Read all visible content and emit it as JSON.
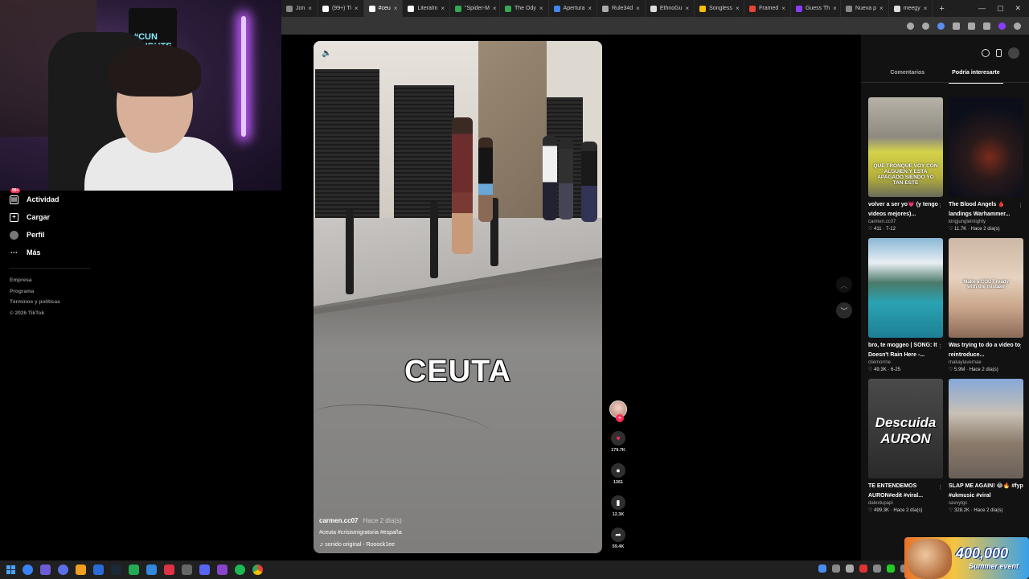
{
  "browser": {
    "tabs": [
      {
        "label": "Jon",
        "color": "#888",
        "active": false
      },
      {
        "label": "(99+) Ti",
        "color": "#fff",
        "active": false
      },
      {
        "label": "#ceu",
        "color": "#fff",
        "active": true
      },
      {
        "label": "Literalm",
        "color": "#fff",
        "active": false
      },
      {
        "label": "\"Spider-M",
        "color": "#34a853",
        "active": false
      },
      {
        "label": "The Ody",
        "color": "#34a853",
        "active": false
      },
      {
        "label": "Apertura",
        "color": "#4285f4",
        "active": false
      },
      {
        "label": "Rule34d",
        "color": "#aaa",
        "active": false
      },
      {
        "label": "EthnoGu",
        "color": "#ddd",
        "active": false
      },
      {
        "label": "Songless",
        "color": "#fbbc05",
        "active": false
      },
      {
        "label": "Framed",
        "color": "#ea4335",
        "active": false
      },
      {
        "label": "Guess Th",
        "color": "#8a3cff",
        "active": false
      },
      {
        "label": "Nueva p",
        "color": "#888",
        "active": false
      },
      {
        "label": "meegy",
        "color": "#ddd",
        "active": false
      }
    ]
  },
  "sidebar": {
    "items": [
      {
        "label": "Actividad",
        "icon": "inbox-icon",
        "badge": "99+"
      },
      {
        "label": "Cargar",
        "icon": "upload-plus-icon"
      },
      {
        "label": "Perfil",
        "icon": "profile-avatar-icon"
      },
      {
        "label": "Más",
        "icon": "more-dots-icon"
      }
    ],
    "footer": [
      "Empresa",
      "Programa",
      "Términos y políticas",
      "© 2026 TikTok"
    ]
  },
  "video": {
    "caption": "CEUTA",
    "author": "carmen.cc07",
    "posted": "Hace 2 día(s)",
    "tags": "#ceuta #crisismigratoria #españa",
    "sound": "sonido original - Rooock1ee",
    "likes": "179.7K",
    "comments": "1361",
    "saves": "12.3K",
    "shares": "59.4K"
  },
  "panel": {
    "tabs": [
      "Comentarios",
      "Podría interesarte"
    ],
    "active_tab": "Podría interesarte",
    "cards": [
      {
        "title": "volver a ser yo💗 (y tengo videos mejores)...",
        "author": "carmen.cc07",
        "stats": "♡ 411 · 7-12",
        "thumb_text": "QUE TRONQUE VOY CON ALGUIEN Y ESTA APAGADO SIENDO YO TAN ESTE",
        "thumb": "yellow"
      },
      {
        "title": "The Blood Angels 🩸 landings Warhammer...",
        "author": "kingjungleimighty",
        "stats": "♡ 11.7K · Hace 2 día(s)",
        "thumb_text": "",
        "thumb": "dark"
      },
      {
        "title": "bro, te moggeo | SONG: It Doesn't Rain Here -...",
        "author": "cliemorrne",
        "stats": "♡ 49.3K · 6-25",
        "thumb_text": "",
        "thumb": "lake"
      },
      {
        "title": "Was trying to do a video to reintroduce...",
        "author": "makaylavernae",
        "stats": "♡ 5.9M · Hace 2 día(s)",
        "thumb_text": "Make a COUT ready with the mistake",
        "thumb": "girl"
      },
      {
        "title": "TE ENTENDEMOS AURON#edit #viral...",
        "author": "dalextupapi",
        "stats": "♡ 499.3K · Hace 2 día(s)",
        "thumb_text": "Descuida AURON",
        "thumb": "auron"
      },
      {
        "title": "SLAP ME AGAIN! 😂🔥 #fyp #ukmusic #viral",
        "author": "savvytgc",
        "stats": "♡ 328.2K · Hace 2 día(s)",
        "thumb_text": "",
        "thumb": "street"
      }
    ]
  },
  "webcam": {
    "poster_text": "#CUN TRIBUTE"
  },
  "event_banner": {
    "number": "400,000",
    "subtitle": "Summer event"
  },
  "colors": {
    "accent": "#fe2c55",
    "panel_bg": "#121212",
    "page_bg": "#000000"
  }
}
